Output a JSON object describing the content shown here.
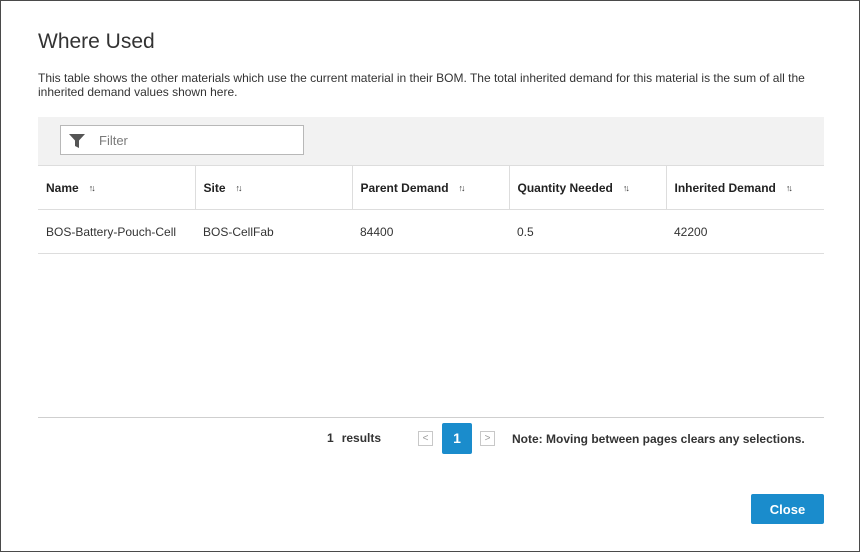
{
  "dialog": {
    "title": "Where Used",
    "description": "This table shows the other materials which use the current material in their BOM. The total inherited demand for this material is the sum of all the inherited demand values shown here."
  },
  "filter": {
    "placeholder": "Filter",
    "icon": "filter-funnel-icon"
  },
  "table": {
    "columns": [
      {
        "label": "Name",
        "sort_icon": "↑↓"
      },
      {
        "label": "Site",
        "sort_icon": "↑↓"
      },
      {
        "label": "Parent Demand",
        "sort_icon": "↑↓"
      },
      {
        "label": "Quantity Needed",
        "sort_icon": "↑↓"
      },
      {
        "label": "Inherited Demand",
        "sort_icon": "↑↓"
      }
    ],
    "rows": [
      [
        "BOS-Battery-Pouch-Cell",
        "BOS-CellFab",
        "84400",
        "0.5",
        "42200"
      ]
    ]
  },
  "pagination": {
    "results_count": "1",
    "results_label": "results",
    "prev_label": "<",
    "current_page": "1",
    "next_label": ">",
    "note": "Note: Moving between pages clears any selections."
  },
  "actions": {
    "close_label": "Close"
  },
  "colors": {
    "accent": "#1a8ccc",
    "toolbar_bg": "#f2f2f2"
  }
}
